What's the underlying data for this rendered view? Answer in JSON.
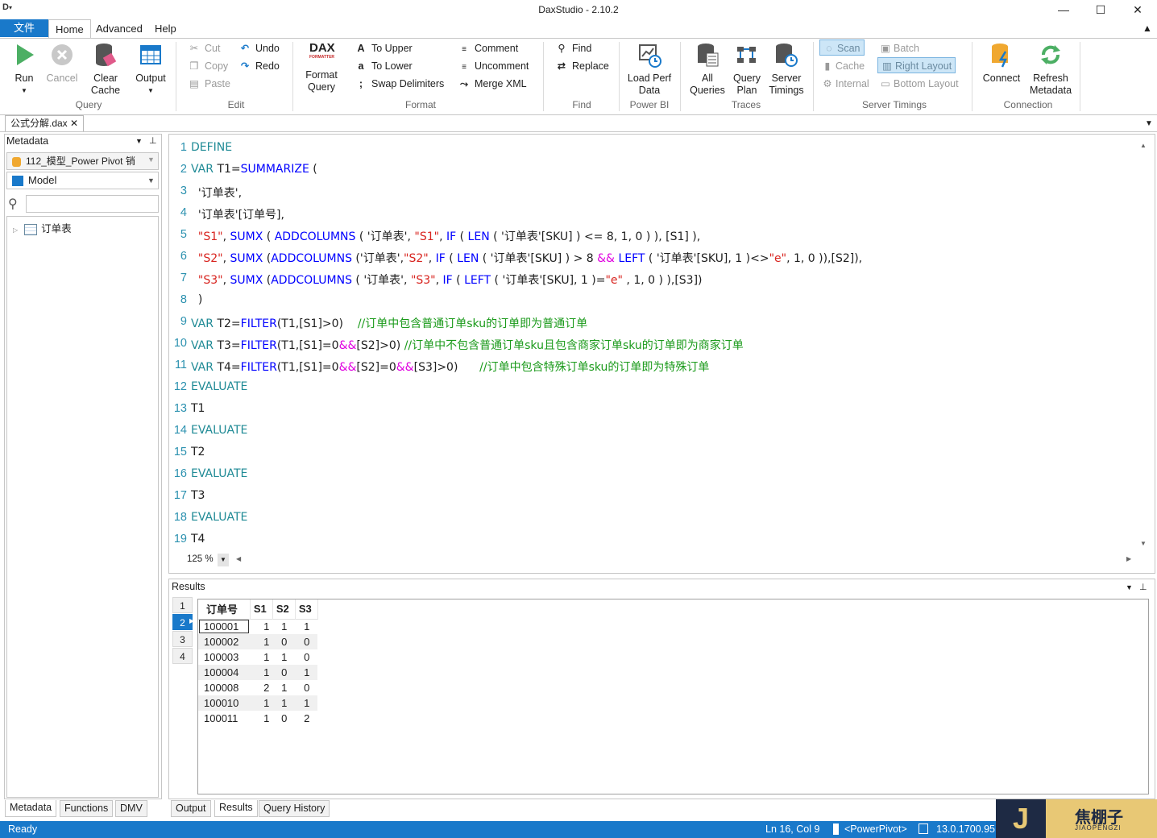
{
  "window": {
    "title": "DaxStudio - 2.10.2",
    "min": "—",
    "max": "☐",
    "close": "✕"
  },
  "ribbon_tabs": {
    "file": "文件",
    "home": "Home",
    "advanced": "Advanced",
    "help": "Help"
  },
  "groups": {
    "query": {
      "label": "Query",
      "run": "Run",
      "cancel": "Cancel",
      "clear_cache": [
        "Clear",
        "Cache"
      ],
      "output": "Output"
    },
    "edit": {
      "label": "Edit",
      "cut": "Cut",
      "copy": "Copy",
      "paste": "Paste",
      "undo": "Undo",
      "redo": "Redo"
    },
    "format": {
      "label": "Format",
      "format_query": [
        "Format",
        "Query"
      ],
      "to_upper": "To Upper",
      "to_lower": "To Lower",
      "swap": "Swap Delimiters",
      "comment": "Comment",
      "uncomment": "Uncomment",
      "merge": "Merge XML"
    },
    "find": {
      "label": "Find",
      "find": "Find",
      "replace": "Replace"
    },
    "powerbi": {
      "label": "Power BI",
      "load": [
        "Load Perf",
        "Data"
      ]
    },
    "traces": {
      "label": "Traces",
      "all": [
        "All",
        "Queries"
      ],
      "plan": [
        "Query",
        "Plan"
      ],
      "timings": [
        "Server",
        "Timings"
      ]
    },
    "server_timings": {
      "label": "Server Timings",
      "scan": "Scan",
      "cache": "Cache",
      "internal": "Internal",
      "batch": "Batch",
      "right_layout": "Right Layout",
      "bottom_layout": "Bottom Layout"
    },
    "connection": {
      "label": "Connection",
      "connect": "Connect",
      "refresh": [
        "Refresh",
        "Metadata"
      ]
    }
  },
  "doc_tab": {
    "name": "公式分解.dax"
  },
  "metadata": {
    "header": "Metadata",
    "model_source": "112_模型_Power Pivot 销",
    "model": "Model",
    "table": "订单表"
  },
  "left_tabs": [
    "Metadata",
    "Functions",
    "DMV"
  ],
  "editor": {
    "zoom": "125 %",
    "line_numbers": [
      "1",
      "2",
      "3",
      "4",
      "5",
      "6",
      "7",
      "8",
      "9",
      "10",
      "11",
      "12",
      "13",
      "14",
      "15",
      "16",
      "17",
      "18",
      "19"
    ]
  },
  "results": {
    "header": "Results",
    "result_sets": [
      "1",
      "2",
      "3",
      "4"
    ],
    "columns": [
      "订单号",
      "S1",
      "S2",
      "S3"
    ],
    "rows": [
      [
        "100001",
        "1",
        "1",
        "1"
      ],
      [
        "100002",
        "1",
        "0",
        "0"
      ],
      [
        "100003",
        "1",
        "1",
        "0"
      ],
      [
        "100004",
        "1",
        "0",
        "1"
      ],
      [
        "100008",
        "2",
        "1",
        "0"
      ],
      [
        "100010",
        "1",
        "1",
        "1"
      ],
      [
        "100011",
        "1",
        "0",
        "2"
      ]
    ]
  },
  "bottom_tabs": [
    "Output",
    "Results",
    "Query History"
  ],
  "status": {
    "ready": "Ready",
    "position": "Ln 16, Col 9",
    "server": "<PowerPivot>",
    "version": "13.0.1700.95"
  },
  "watermark": {
    "letter": "J",
    "cn": "焦棚子",
    "en": "JIAOPENGZI"
  },
  "colors": {
    "accent": "#1979ca",
    "keyword": "#1f8a95",
    "function": "#0000ff",
    "string": "#d8241f",
    "operator": "#e000e0",
    "comment": "#1a9a1a"
  }
}
